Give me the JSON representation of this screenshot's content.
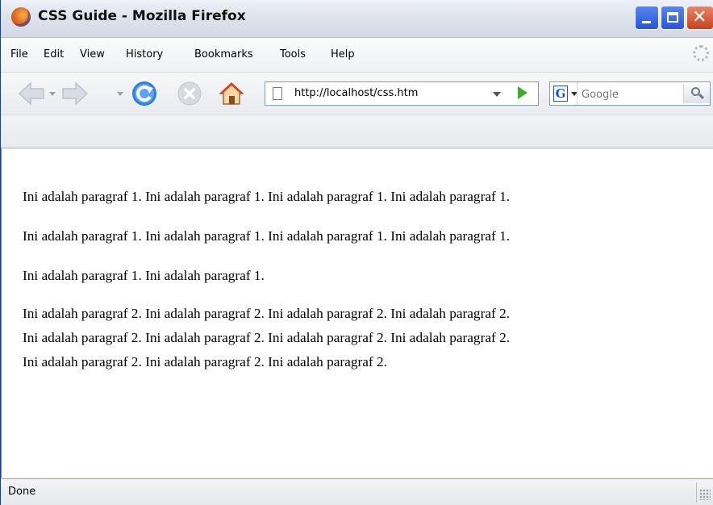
{
  "window": {
    "title": "CSS Guide - Mozilla Firefox"
  },
  "menubar": {
    "items": [
      "File",
      "Edit",
      "View",
      "History",
      "Bookmarks",
      "Tools",
      "Help"
    ]
  },
  "navbar": {
    "url": "http://localhost/css.htm",
    "search_placeholder": "Google",
    "search_engine": "G"
  },
  "content": {
    "paragraph1_lines": [
      "Ini adalah paragraf 1. Ini adalah paragraf 1. Ini adalah paragraf 1. Ini adalah paragraf 1.",
      "Ini adalah paragraf 1. Ini adalah paragraf 1. Ini adalah paragraf 1. Ini adalah paragraf 1.",
      "Ini adalah paragraf 1. Ini adalah paragraf 1."
    ],
    "paragraph2_lines": [
      "Ini adalah paragraf 2. Ini adalah paragraf 2. Ini adalah paragraf 2. Ini adalah paragraf 2.",
      "Ini adalah paragraf 2. Ini adalah paragraf 2. Ini adalah paragraf 2. Ini adalah paragraf 2.",
      "Ini adalah paragraf 2. Ini adalah paragraf 2. Ini adalah paragraf 2."
    ]
  },
  "statusbar": {
    "text": "Done"
  },
  "colors": {
    "titlebar_close": "#c6401b",
    "titlebar_buttons": "#2656d9",
    "go_arrow": "#3fae2c",
    "reload": "#2f7fe0"
  },
  "icons": [
    "firefox-logo-icon",
    "back-icon",
    "forward-icon",
    "reload-icon",
    "stop-icon",
    "home-icon",
    "page-icon",
    "go-icon",
    "google-icon",
    "search-icon",
    "throbber-icon",
    "resize-grip-icon"
  ]
}
